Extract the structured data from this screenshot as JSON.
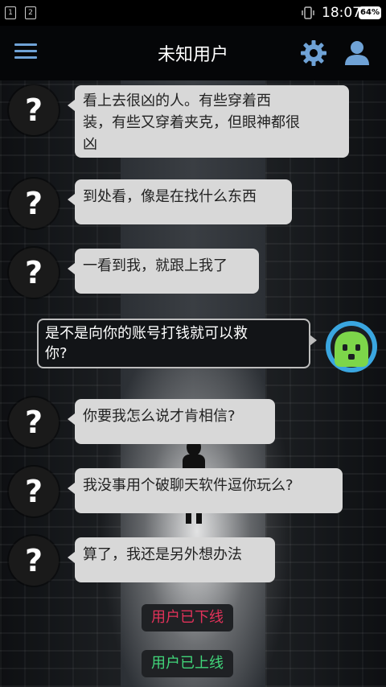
{
  "status_bar": {
    "sim1": "1",
    "sim2": "2",
    "time": "18:07",
    "battery": "64%"
  },
  "header": {
    "title": "未知用户",
    "menu_icon": "menu-icon",
    "settings_icon": "gear-icon",
    "profile_icon": "user-icon",
    "accent_color": "#6fa2d6"
  },
  "messages": [
    {
      "sender": "unknown",
      "avatar": "?",
      "text_lines": [
        "看上去很凶的人。有些穿着西",
        "装，有些又穿着夹克，但眼神都很",
        "凶"
      ]
    },
    {
      "sender": "unknown",
      "avatar": "?",
      "text_lines": [
        "到处看，像是在找什么东西"
      ]
    },
    {
      "sender": "unknown",
      "avatar": "?",
      "text_lines": [
        "一看到我，就跟上我了"
      ]
    },
    {
      "sender": "me",
      "text_lines": [
        "是不是向你的账号打钱就可以救",
        "你?"
      ]
    },
    {
      "sender": "unknown",
      "avatar": "?",
      "text_lines": [
        "你要我怎么说才肯相信?"
      ]
    },
    {
      "sender": "unknown",
      "avatar": "?",
      "text_lines": [
        "我没事用个破聊天软件逗你玩么?"
      ]
    },
    {
      "sender": "unknown",
      "avatar": "?",
      "text_lines": [
        "算了，我还是另外想办法"
      ]
    }
  ],
  "system_notices": {
    "offline": "用户已下线",
    "online": "用户已上线",
    "offline_color": "#e2325a",
    "online_color": "#41d67a"
  }
}
